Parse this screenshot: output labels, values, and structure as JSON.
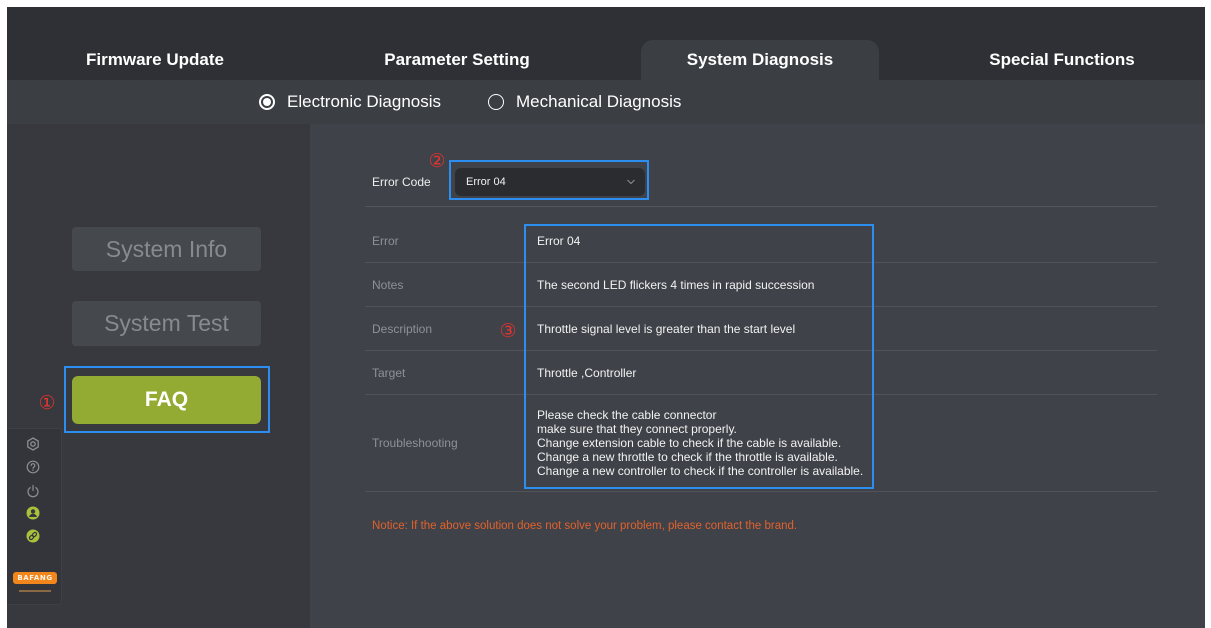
{
  "tabs": [
    {
      "label": "Firmware Update",
      "active": false
    },
    {
      "label": "Parameter Setting",
      "active": false
    },
    {
      "label": "System Diagnosis",
      "active": true
    },
    {
      "label": "Special Functions",
      "active": false
    }
  ],
  "diagnosis_modes": [
    {
      "label": "Electronic Diagnosis",
      "selected": true
    },
    {
      "label": "Mechanical Diagnosis",
      "selected": false
    }
  ],
  "sidebar": {
    "buttons": [
      {
        "label": "System Info",
        "active": false
      },
      {
        "label": "System Test",
        "active": false
      },
      {
        "label": "FAQ",
        "active": true
      }
    ],
    "toolbar_icons": [
      "settings-icon",
      "help-icon",
      "power-icon",
      "user-icon",
      "link-icon"
    ],
    "logo_text": "BAFANG"
  },
  "annotations": {
    "marker_1": "①",
    "marker_2": "②",
    "marker_3": "③"
  },
  "error_code": {
    "label": "Error Code",
    "selected": "Error 04"
  },
  "details": [
    {
      "label": "Error",
      "value": "Error 04"
    },
    {
      "label": "Notes",
      "value": "The second LED flickers 4 times in rapid succession"
    },
    {
      "label": "Description",
      "value": "Throttle signal level is greater than the start level"
    },
    {
      "label": "Target",
      "value": "Throttle ,Controller"
    },
    {
      "label": "Troubleshooting",
      "lines": [
        "Please check the cable connector",
        "make sure that they connect properly.",
        "Change extension cable to check if the cable is available.",
        "Change a new throttle to check if the throttle is available.",
        "Change a new controller to check if the controller is available."
      ]
    }
  ],
  "notice": "Notice: If the above solution does not solve your problem, please contact the brand.",
  "colors": {
    "accent": "#94ab33",
    "notice": "#e2622d",
    "annotation_red": "#e3342f",
    "annotation_blue": "#2b8ef0",
    "logo": "#f0861c"
  }
}
